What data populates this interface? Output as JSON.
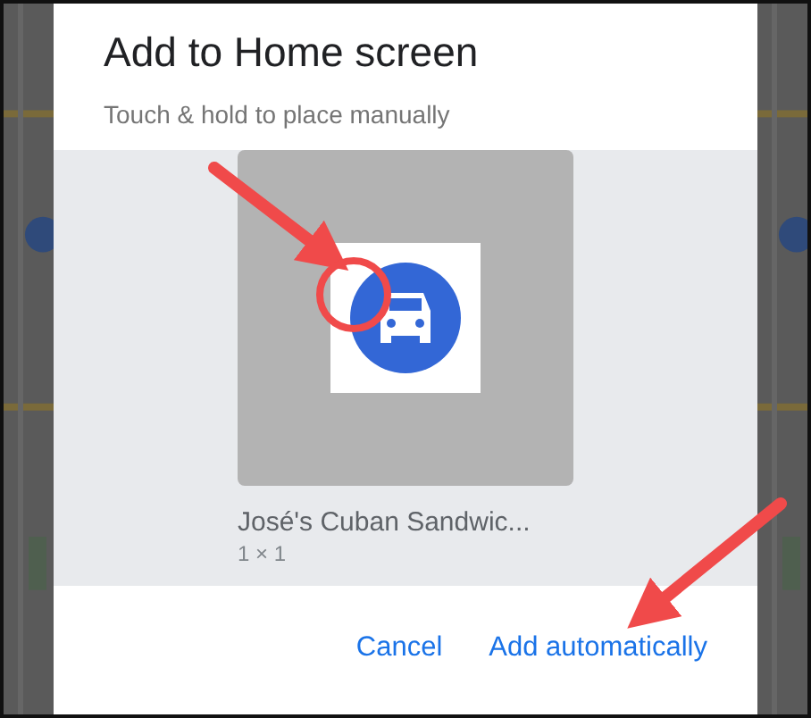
{
  "dialog": {
    "title": "Add to Home screen",
    "subtitle": "Touch & hold to place manually"
  },
  "widget": {
    "label": "José's Cuban Sandwic...",
    "size": "1 × 1"
  },
  "buttons": [
    {
      "label": "Cancel"
    },
    {
      "label": "Add automatically"
    }
  ]
}
